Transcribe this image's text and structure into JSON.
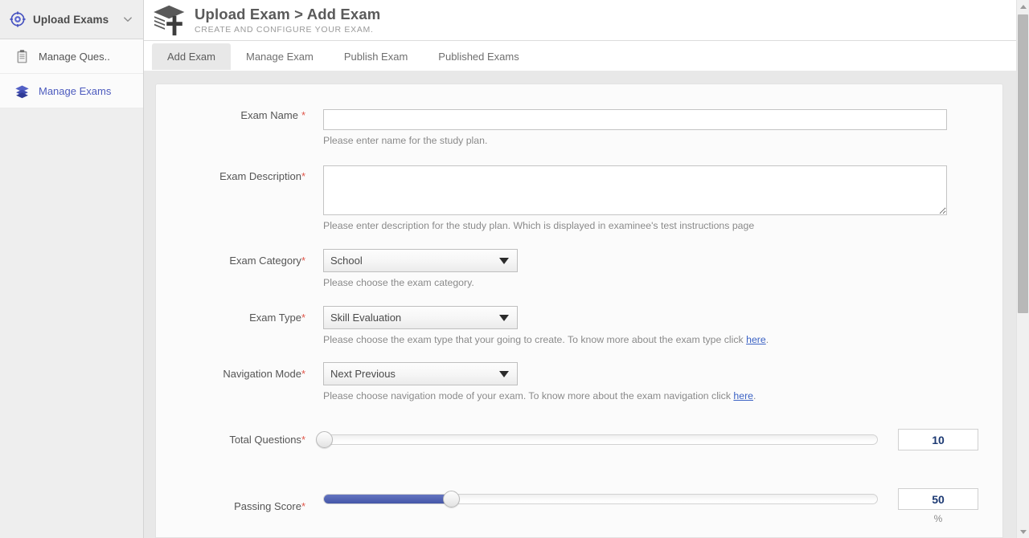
{
  "sidebar": {
    "header": {
      "title": "Upload Exams",
      "logo_icon": "target-crosshair-icon",
      "chevron_icon": "chevron-down-icon"
    },
    "items": [
      {
        "label": "Manage Ques..",
        "icon": "clipboard-icon",
        "active": false
      },
      {
        "label": "Manage Exams",
        "icon": "layers-stack-icon",
        "active": true
      }
    ]
  },
  "header": {
    "logo_icon": "graduation-cap-plus-icon",
    "title": "Upload Exam > Add Exam",
    "subtitle": "CREATE AND CONFIGURE YOUR EXAM."
  },
  "tabs": [
    {
      "label": "Add Exam",
      "active": true
    },
    {
      "label": "Manage Exam",
      "active": false
    },
    {
      "label": "Publish Exam",
      "active": false
    },
    {
      "label": "Published Exams",
      "active": false
    }
  ],
  "form": {
    "exam_name": {
      "label": "Exam Name",
      "required_mark": "*",
      "value": "",
      "placeholder": "",
      "hint": "Please enter name for the study plan."
    },
    "exam_description": {
      "label": "Exam Description",
      "required_mark": "*",
      "value": "",
      "placeholder": "",
      "hint": "Please enter description for the study plan. Which is displayed in examinee's test instructions page"
    },
    "exam_category": {
      "label": "Exam Category",
      "required_mark": "*",
      "value": "School",
      "hint": "Please choose the exam category.",
      "arrow_icon": "caret-down-icon"
    },
    "exam_type": {
      "label": "Exam Type",
      "required_mark": "*",
      "value": "Skill Evaluation",
      "hint_before": "Please choose the exam type that your going to create. To know more about the exam type click ",
      "hint_link": "here",
      "hint_after": ".",
      "arrow_icon": "caret-down-icon"
    },
    "navigation_mode": {
      "label": "Navigation Mode",
      "required_mark": "*",
      "value": "Next Previous",
      "hint_before": "Please choose navigation mode of your exam. To know more about the exam navigation click ",
      "hint_link": "here",
      "hint_after": ".",
      "arrow_icon": "caret-down-icon"
    },
    "total_questions": {
      "label": "Total Questions",
      "required_mark": "*",
      "value": "10",
      "percent_filled": 0
    },
    "passing_score": {
      "label": "Passing Score",
      "required_mark": "*",
      "value": "50",
      "percent_filled": 23,
      "unit": "%"
    }
  },
  "scrollbar": {
    "up_icon": "scroll-up-arrow-icon",
    "down_icon": "scroll-down-arrow-icon"
  },
  "colors": {
    "accent_blue": "#4d5bbe",
    "slider_fill": "#4456a8",
    "required_red": "#e0574b",
    "link_blue": "#3b62c4",
    "number_navy": "#1d3a73"
  }
}
